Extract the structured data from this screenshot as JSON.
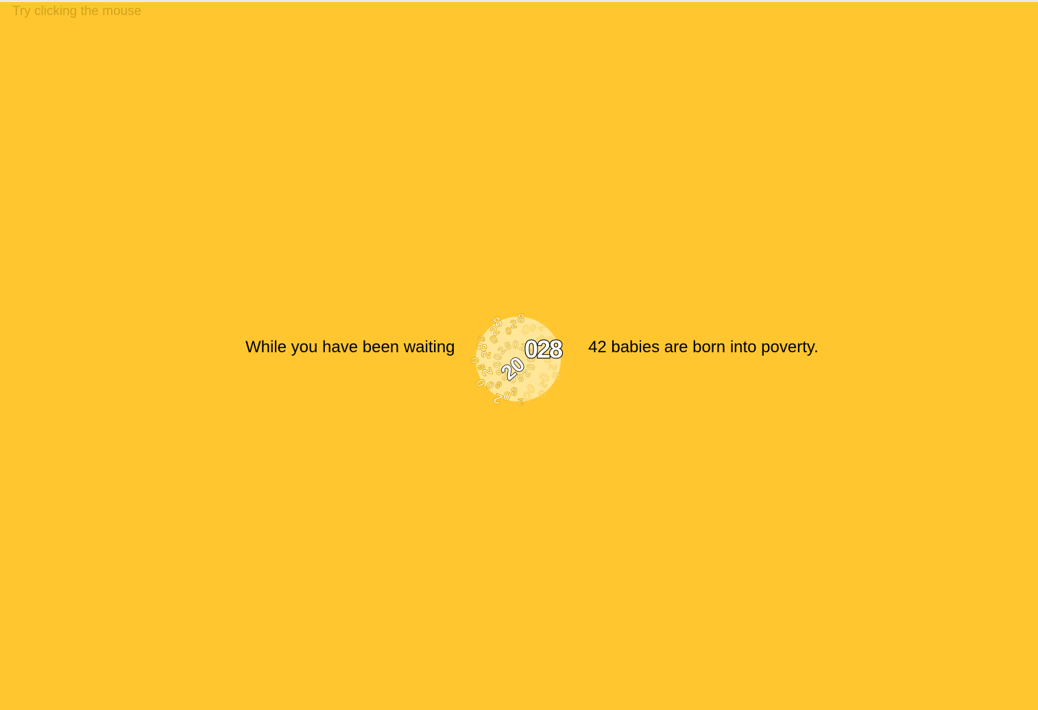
{
  "hint_text": "Try clicking the mouse",
  "message": {
    "prefix": "While you have been waiting",
    "counter_value": "028",
    "suffix": "42 babies are born into poverty."
  },
  "colors": {
    "background": "#ffc630",
    "hint": "#d0a31c",
    "text": "#000000",
    "counter_fill": "#ffffff"
  },
  "icons": {
    "counter_graphic": "spinning-number-burst-icon"
  }
}
